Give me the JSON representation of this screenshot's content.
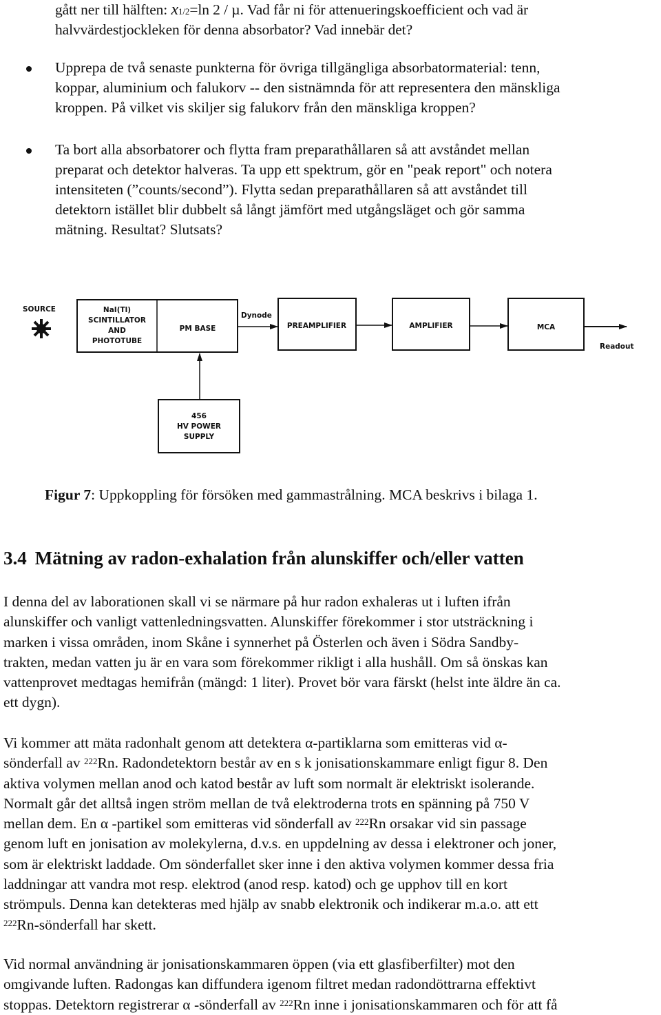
{
  "top_paragraph": {
    "line1_pre": "gått ner till hälften: ",
    "line1_var": "x",
    "line1_sub": "1/2",
    "line1_post": "=ln 2 / µ. Vad får ni för attenueringskoefficient och vad är",
    "line2": "halvvärdestjockleken för denna absorbator? Vad innebär det?"
  },
  "bullets": [
    {
      "lines": [
        "Upprepa de två senaste punkterna för övriga tillgängliga absorbatormaterial: tenn,",
        "koppar, aluminium och falukorv -- den sistnämnda för att representera den mänskliga",
        "kroppen. På vilket vis skiljer sig falukorv från den mänskliga kroppen?"
      ]
    },
    {
      "lines": [
        "Ta bort alla absorbatorer och flytta fram preparathållaren så att avståndet mellan",
        "preparat och detektor halveras. Ta upp ett spektrum, gör en \"peak report\" och notera",
        "intensiteten (”counts/second”). Flytta sedan preparathållaren så att avståndet till",
        "detektorn istället blir dubbelt så långt jämfört med utgångsläget och gör samma",
        "mätning. Resultat? Slutsats?"
      ]
    }
  ],
  "diagram": {
    "source_label": "SOURCE",
    "scintillator_lines": [
      "NaI(Tl)",
      "SCINTILLATOR",
      "AND",
      "PHOTOTUBE"
    ],
    "pm_base": "PM BASE",
    "dynode_label": "Dynode",
    "preamplifier": "PREAMPLIFIER",
    "amplifier": "AMPLIFIER",
    "mca": "MCA",
    "readout_label": "Readout",
    "hv_lines": [
      "456",
      "HV POWER",
      "SUPPLY"
    ]
  },
  "caption": {
    "label": "Figur 7",
    "text": ": Uppkoppling för försöken med gammastrålning. MCA beskrivs i bilaga 1."
  },
  "section": {
    "number": "3.4",
    "title": "Mätning av radon-exhalation från alunskiffer och/eller vatten"
  },
  "paragraphs": {
    "p1": [
      "I denna del av laborationen skall vi se närmare på hur radon exhaleras ut i luften ifrån",
      "alunskiffer och vanligt vattenledningsvatten. Alunskiffer förekommer i stor utsträckning i",
      "marken i vissa områden, inom Skåne i synnerhet på Österlen och även i Södra Sandby-",
      "trakten, medan vatten ju är en vara som förekommer rikligt i alla hushåll. Om så önskas kan",
      "vattenprovet medtagas hemifrån (mängd: 1 liter). Provet bör vara färskt (helst inte äldre än ca.",
      "ett dygn)."
    ],
    "p2": {
      "l1": "Vi kommer att mäta radonhalt genom att detektera α-partiklarna som emitteras vid α-",
      "l2_pre": "sönderfall av ",
      "l2_sup": "222",
      "l2_post": "Rn. Radondetektorn består av en s k jonisationskammare enligt figur 8. Den",
      "l3": "aktiva volymen mellan anod och katod består av luft som normalt är elektriskt isolerande.",
      "l4": "Normalt går det alltså ingen ström mellan de två elektroderna trots en spänning på 750 V",
      "l5_pre": "mellan dem. En α -partikel som emitteras vid sönderfall av ",
      "l5_sup": "222",
      "l5_post": "Rn orsakar vid sin passage",
      "l6": "genom luft en jonisation av molekylerna, d.v.s. en uppdelning av dessa i elektroner och joner,",
      "l7": "som är elektriskt laddade. Om sönderfallet sker inne i den aktiva volymen kommer dessa fria",
      "l8": "laddningar att vandra mot resp. elektrod (anod resp. katod) och ge upphov till en kort",
      "l9": "strömpuls. Denna kan detekteras med hjälp av snabb elektronik och indikerar m.a.o. att ett",
      "l10_sup": "222",
      "l10_post": "Rn-sönderfall har skett."
    },
    "p3": {
      "l1": "Vid normal användning är jonisationskammaren öppen (via ett glasfiberfilter) mot den",
      "l2": "omgivande luften. Radongas kan diffundera igenom filtret medan radondöttrarna effektivt",
      "l3_pre": "stoppas. Detektorn registrerar α -sönderfall av ",
      "l3_sup": "222",
      "l3_post": "Rn inne i jonisationskammaren och för att få"
    }
  }
}
